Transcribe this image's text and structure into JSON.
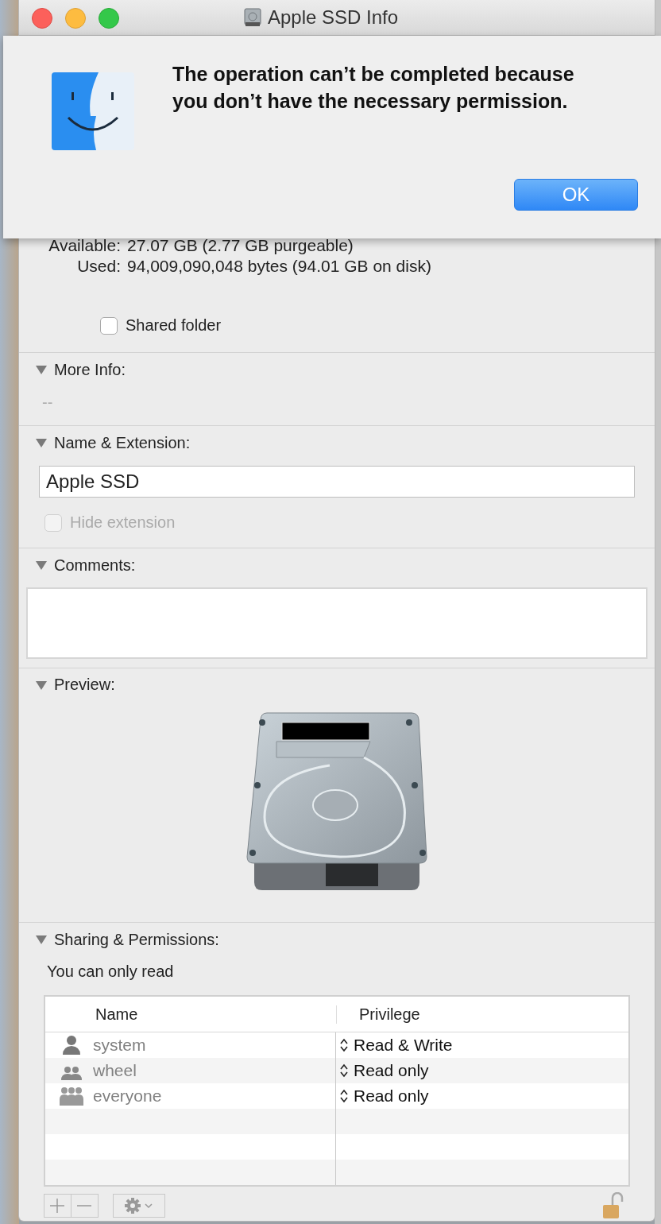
{
  "window": {
    "title": "Apple SSD Info"
  },
  "alert": {
    "message": "The operation can’t be completed because you don’t have the necessary permission.",
    "buttons": [
      {
        "label": "OK",
        "default": true
      }
    ]
  },
  "general": {
    "rows": [
      {
        "label": "Available:",
        "value": "27.07 GB (2.77 GB purgeable)"
      },
      {
        "label": "Used:",
        "value": "94,009,090,048 bytes (94.01 GB on disk)"
      }
    ],
    "shared_folder": {
      "label": "Shared folder",
      "checked": false
    }
  },
  "sections": [
    {
      "kind": "info",
      "title": "More Info:",
      "expanded": true,
      "text": "--"
    },
    {
      "kind": "name",
      "title": "Name & Extension:",
      "expanded": true,
      "value": "Apple SSD",
      "hide_extension": {
        "label": "Hide extension",
        "checked": false,
        "disabled": true
      }
    },
    {
      "kind": "comments",
      "title": "Comments:",
      "expanded": true
    },
    {
      "kind": "preview",
      "title": "Preview:",
      "expanded": true
    },
    {
      "kind": "sharing",
      "title": "Sharing & Permissions:",
      "expanded": true,
      "note": "You can only read",
      "columns": [
        "Name",
        "Privilege"
      ],
      "locked": false,
      "rows": [
        {
          "name": "system",
          "kind": "user",
          "privilege": "Read & Write"
        },
        {
          "name": "wheel",
          "kind": "group",
          "privilege": "Read only"
        },
        {
          "name": "everyone",
          "kind": "everyone",
          "privilege": "Read only"
        }
      ]
    }
  ]
}
